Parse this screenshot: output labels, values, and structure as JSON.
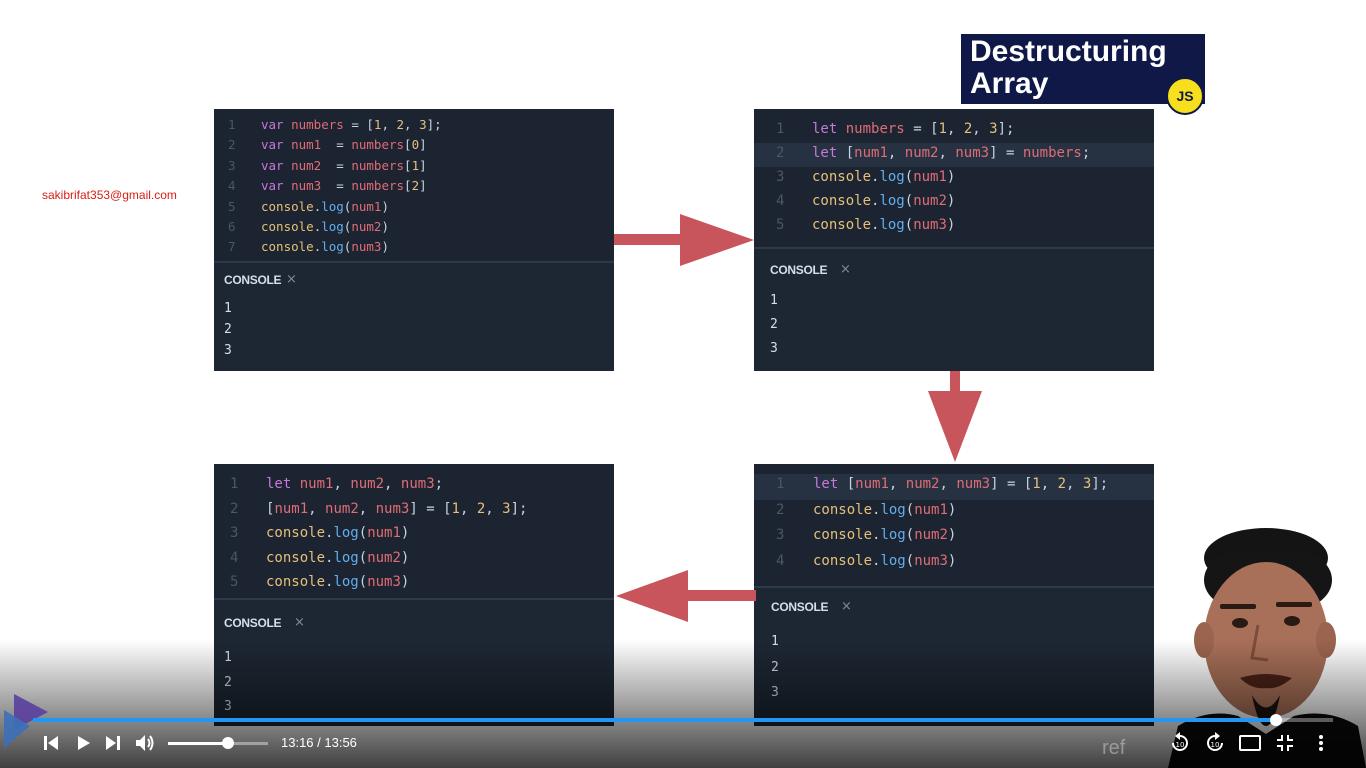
{
  "player": {
    "current_time": "13:16",
    "duration": "13:56",
    "time_display": "13:16 / 13:56",
    "progress_fraction": 0.956,
    "volume_fraction": 0.6,
    "watermark_text": "ref"
  },
  "slide": {
    "email": "sakibrifat353@gmail.com",
    "title_line1": "Destructuring",
    "title_line2": "Array",
    "badge": "JS",
    "console_label": "CONSOLE",
    "close_glyph": "×",
    "panels": [
      {
        "id": "top-left",
        "lines": [
          {
            "n": "1",
            "text": "var numbers = [1, 2, 3];"
          },
          {
            "n": "2",
            "text": "var num1  = numbers[0]"
          },
          {
            "n": "3",
            "text": "var num2  = numbers[1]"
          },
          {
            "n": "4",
            "text": "var num3  = numbers[2]"
          },
          {
            "n": "5",
            "text": "console.log(num1)"
          },
          {
            "n": "6",
            "text": "console.log(num2)"
          },
          {
            "n": "7",
            "text": "console.log(num3)"
          }
        ],
        "output": [
          "1",
          "2",
          "3"
        ]
      },
      {
        "id": "top-right",
        "lines": [
          {
            "n": "1",
            "text": "let numbers = [1, 2, 3];"
          },
          {
            "n": "2",
            "text": "let [num1, num2, num3] = numbers;"
          },
          {
            "n": "3",
            "text": "console.log(num1)"
          },
          {
            "n": "4",
            "text": "console.log(num2)"
          },
          {
            "n": "5",
            "text": "console.log(num3)"
          }
        ],
        "output": [
          "1",
          "2",
          "3"
        ]
      },
      {
        "id": "bottom-right",
        "lines": [
          {
            "n": "1",
            "text": "let [num1, num2, num3] = [1, 2, 3];"
          },
          {
            "n": "2",
            "text": "console.log(num1)"
          },
          {
            "n": "3",
            "text": "console.log(num2)"
          },
          {
            "n": "4",
            "text": "console.log(num3)"
          }
        ],
        "output": [
          "1",
          "2",
          "3"
        ]
      },
      {
        "id": "bottom-left",
        "lines": [
          {
            "n": "1",
            "text": "let num1, num2, num3;"
          },
          {
            "n": "2",
            "text": "[num1, num2, num3] = [1, 2, 3];"
          },
          {
            "n": "3",
            "text": "console.log(num1)"
          },
          {
            "n": "4",
            "text": "console.log(num2)"
          },
          {
            "n": "5",
            "text": "console.log(num3)"
          }
        ],
        "output": [
          "1",
          "2",
          "3"
        ]
      }
    ]
  },
  "icons": {
    "prev": "skip-previous-icon",
    "play": "play-icon",
    "next": "skip-next-icon",
    "volume": "volume-icon",
    "rewind": "rewind-10-icon",
    "forward": "forward-10-icon",
    "theater": "theater-mode-icon",
    "exit_fullscreen": "exit-fullscreen-icon",
    "more": "more-vertical-icon"
  },
  "colors": {
    "arrow": "#c9555c",
    "progress": "#2196f3",
    "editor_bg": "#1b2430",
    "badge_bg": "#0f1846",
    "js_yellow": "#f7df1e",
    "email": "#d91e18"
  }
}
